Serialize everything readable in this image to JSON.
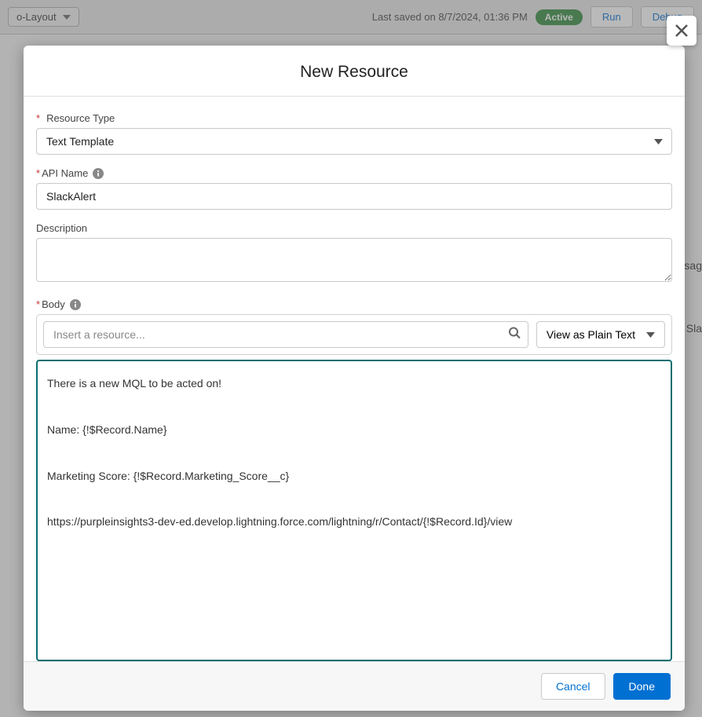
{
  "topBar": {
    "layoutLabel": "o-Layout",
    "lastSaved": "Last saved on 8/7/2024, 01:36 PM",
    "activeBadge": "Active",
    "runLabel": "Run",
    "debugLabel": "Debug"
  },
  "modal": {
    "title": "New Resource",
    "fields": {
      "resourceType": {
        "label": "Resource Type",
        "value": "Text Template"
      },
      "apiName": {
        "label": "API Name",
        "value": "SlackAlert"
      },
      "description": {
        "label": "Description",
        "value": ""
      },
      "body": {
        "label": "Body",
        "resourcePlaceholder": "Insert a resource...",
        "viewModeLabel": "View as Plain Text",
        "content": "There is a new MQL to be acted on!\n\nName: {!$Record.Name}\n\nMarketing Score: {!$Record.Marketing_Score__c}\n\nhttps://purpleinsights3-dev-ed.develop.lightning.force.com/lightning/r/Contact/{!$Record.Id}/view"
      }
    },
    "footer": {
      "cancel": "Cancel",
      "done": "Done"
    }
  },
  "backgroundHints": {
    "sag": "sag",
    "sla": "Sla"
  }
}
